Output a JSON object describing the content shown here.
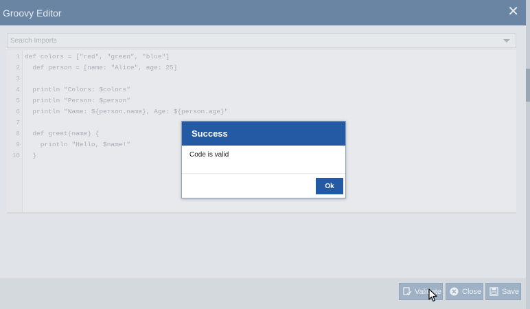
{
  "dialog": {
    "title": "Groovy Editor",
    "close_glyph": "✕"
  },
  "imports": {
    "placeholder": "Search Imports"
  },
  "editor": {
    "lines": [
      {
        "n": "1",
        "code": "def colors = [\"red\", \"green\", \"blue\"]"
      },
      {
        "n": "2",
        "code": "  def person = [name: \"Alice\", age: 25]"
      },
      {
        "n": "3",
        "code": ""
      },
      {
        "n": "4",
        "code": "  println \"Colors: $colors\""
      },
      {
        "n": "5",
        "code": "  println \"Person: $person\""
      },
      {
        "n": "6",
        "code": "  println \"Name: ${person.name}, Age: ${person.age}\""
      },
      {
        "n": "7",
        "code": ""
      },
      {
        "n": "8",
        "code": "  def greet(name) {"
      },
      {
        "n": "9",
        "code": "    println \"Hello, $name!\""
      },
      {
        "n": "10",
        "code": "  }"
      }
    ]
  },
  "footer": {
    "validate_label": "Validate",
    "close_label": "Close",
    "save_label": "Save"
  },
  "modal": {
    "title": "Success",
    "message": "Code is valid",
    "ok_label": "Ok"
  },
  "icons": {
    "validate": "validate-icon",
    "close": "close-circle-icon",
    "save": "save-icon"
  }
}
